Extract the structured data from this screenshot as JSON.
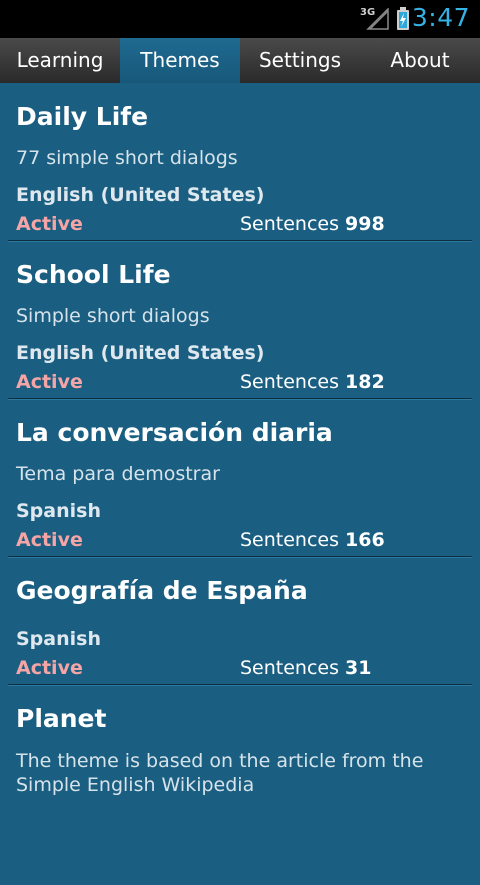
{
  "status_bar": {
    "network": "3G",
    "time": "3:47",
    "colors": {
      "time": "#36b3e6"
    }
  },
  "tabs": [
    {
      "label": "Learning",
      "active": false
    },
    {
      "label": "Themes",
      "active": true
    },
    {
      "label": "Settings",
      "active": false
    },
    {
      "label": "About",
      "active": false
    }
  ],
  "themes": [
    {
      "title": "Daily Life",
      "description": "77 simple short dialogs",
      "language": "English (United States)",
      "status": "Active",
      "sentences_label": "Sentences",
      "sentences_count": "998"
    },
    {
      "title": "School Life",
      "description": "Simple short dialogs",
      "language": "English (United States)",
      "status": "Active",
      "sentences_label": "Sentences",
      "sentences_count": "182"
    },
    {
      "title": "La conversación diaria",
      "description": "Tema para demostrar",
      "language": "Spanish",
      "status": "Active",
      "sentences_label": "Sentences",
      "sentences_count": "166"
    },
    {
      "title": "Geografía de España",
      "language": "Spanish",
      "status": "Active",
      "sentences_label": "Sentences",
      "sentences_count": "31"
    },
    {
      "title": "Planet",
      "description": "The theme is based on the article from the Simple English Wikipedia"
    }
  ],
  "colors": {
    "background": "#1a5f82",
    "status_active": "#f5a5a5",
    "tab_bar": "#333333"
  }
}
